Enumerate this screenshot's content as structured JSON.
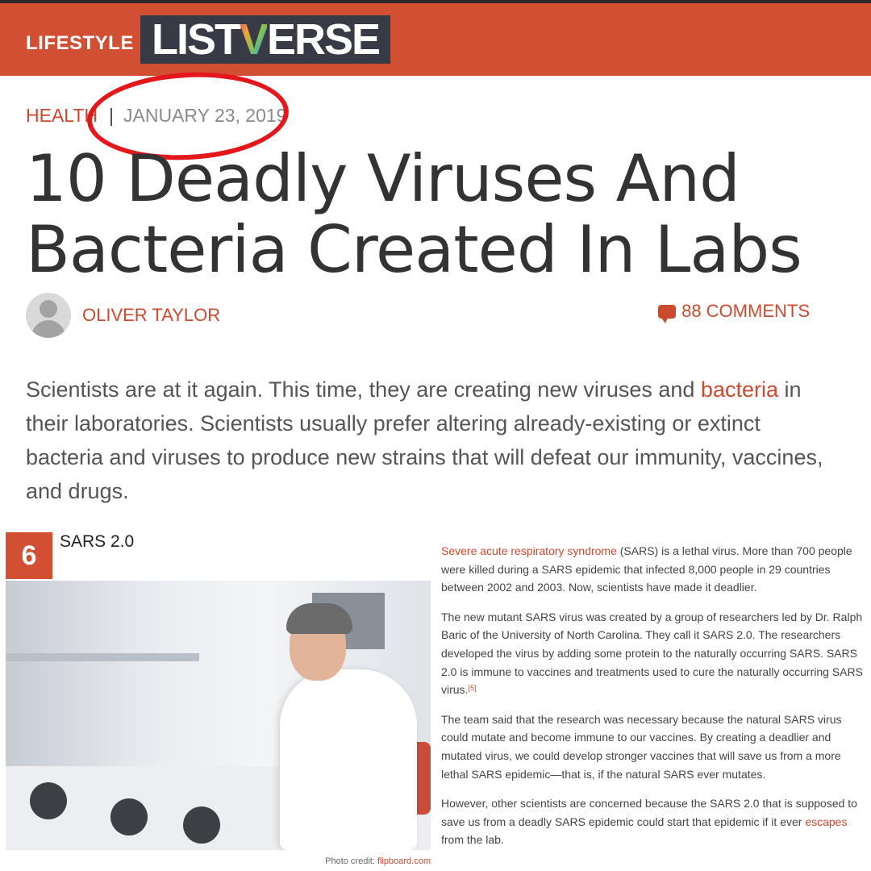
{
  "header": {
    "category": "LIFESTYLE",
    "logo": {
      "part1": "LIST",
      "v": "V",
      "part2": "ERSE"
    }
  },
  "meta": {
    "category": "HEALTH",
    "separator": "|",
    "date": "JANUARY 23, 2019"
  },
  "title": "10 Deadly Viruses And Bacteria Created In Labs",
  "author": {
    "name": "OLIVER TAYLOR"
  },
  "comments": {
    "label": "88 COMMENTS",
    "icon": "comment-icon"
  },
  "intro": {
    "before": "Scientists are at it again. This time, they are creating new viruses and ",
    "link": "bacteria",
    "after": " in their laboratories. Scientists usually prefer altering already-existing or extinct bacteria and viruses to produce new strains that will defeat our immunity, vaccines, and drugs."
  },
  "item": {
    "number": "6",
    "title": "SARS 2.0",
    "photo_credit_label": "Photo credit: ",
    "photo_credit_source": "flipboard.com",
    "p1_link": "Severe acute respiratory syndrome",
    "p1_rest": " (SARS) is a lethal virus. More than 700 people were killed during a SARS epidemic that infected 8,000 people in 29 countries between 2002 and 2003. Now, scientists have made it deadlier.",
    "p2": "The new mutant SARS virus was created by a group of researchers led by Dr. Ralph Baric of the University of North Carolina. They call it SARS 2.0. The researchers developed the virus by adding some protein to the naturally occurring SARS. SARS 2.0 is immune to vaccines and treatments used to cure the naturally occurring SARS virus.",
    "p2_ref": "[5]",
    "p3": "The team said that the research was necessary because the natural SARS virus could mutate and become immune to our vaccines. By creating a deadlier and mutated virus, we could develop stronger vaccines that will save us from a more lethal SARS epidemic—that is, if the natural SARS ever mutates.",
    "p4_before": "However, other scientists are concerned because the SARS 2.0 that is supposed to save us from a deadly SARS epidemic could start that epidemic if it ever ",
    "p4_link": "escapes",
    "p4_after": " from the lab."
  },
  "colors": {
    "brand": "#d14f33",
    "annotation": "#e4181c"
  }
}
